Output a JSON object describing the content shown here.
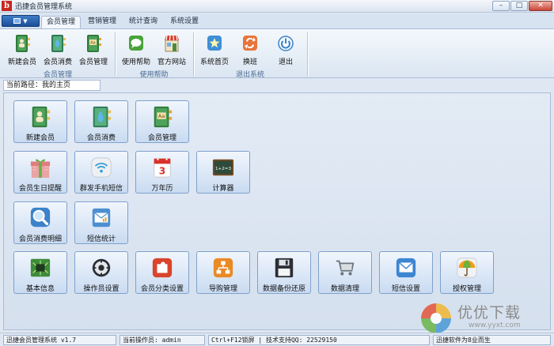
{
  "window": {
    "title": "迅捷会员管理系统"
  },
  "tabs": [
    "会员管理",
    "营销管理",
    "统计查询",
    "系统设置"
  ],
  "ribbon": {
    "groups": [
      {
        "label": "会员管理",
        "buttons": [
          "新建会员",
          "会员消费",
          "会员管理"
        ]
      },
      {
        "label": "使用帮助",
        "buttons": [
          "使用帮助",
          "官方网站"
        ]
      },
      {
        "label": "退出系统",
        "buttons": [
          "系统首页",
          "换班",
          "退出"
        ]
      }
    ]
  },
  "path": {
    "label": "当前路径：我的主页"
  },
  "tiles": {
    "row1": [
      "新建会员",
      "会员消费",
      "会员管理"
    ],
    "row2": [
      "会员生日提醒",
      "群发手机短信",
      "万年历",
      "计算器"
    ],
    "row3": [
      "会员消费明细",
      "短信统计"
    ],
    "row4": [
      "基本信息",
      "操作员设置",
      "会员分类设置",
      "导购管理",
      "数据备份还原",
      "数据清理",
      "短信设置",
      "授权管理"
    ]
  },
  "status": {
    "version": "迅捷会员管理系统 v1.7",
    "operator": "当前操作员: admin",
    "hotkey": "Ctrl+F12锁屏 | 技术支持QQ: 22529150",
    "owner": "迅捷软件为8业而生"
  },
  "icons": {
    "app": "app-logo-icon",
    "calendar_day": "3",
    "calculator_text": "1+2=3"
  },
  "watermark": {
    "text": "优优下载",
    "url": "www.yyxt.com"
  }
}
